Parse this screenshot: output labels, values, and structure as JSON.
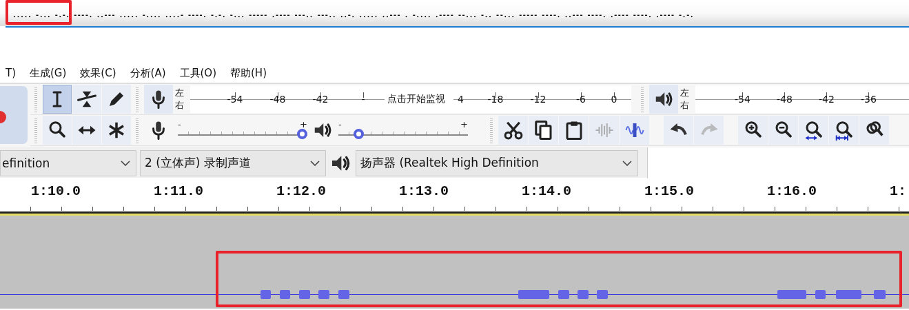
{
  "title_bar": {
    "text": "..... -... -.-. ----. ..--- ..... -.... ....- ----. -.-. -... ----- .---- ---.. ---.. ..-. ..... ..--- . -.... .---- --... -.. --... ----- ----. ..--- ----. .---- ----. .---- -.-.",
    "highlighted": true
  },
  "track": {
    "highlighted": true
  },
  "menu": [
    {
      "label": "T)"
    },
    {
      "label": "生成(G)"
    },
    {
      "label": "效果(C)"
    },
    {
      "label": "分析(A)"
    },
    {
      "label": "工具(O)"
    },
    {
      "label": "帮助(H)"
    }
  ],
  "tools": [
    {
      "kind": "ibeam",
      "selected": true
    },
    {
      "kind": "envelope",
      "selected": false
    },
    {
      "kind": "pencil",
      "selected": false
    },
    {
      "kind": "zoom",
      "selected": false
    },
    {
      "kind": "timeshift",
      "selected": false
    },
    {
      "kind": "multi",
      "selected": false
    }
  ],
  "record_meter": {
    "channels": [
      "左",
      "右"
    ],
    "ticks": [
      "-54",
      "-48",
      "-42",
      "-"
    ],
    "hint": "点击开始监视",
    "ticks_after": [
      "4",
      "-18",
      "-12",
      "-6",
      "0"
    ]
  },
  "playback_meter": {
    "channels": [
      "左",
      "右"
    ],
    "ticks": [
      "-54",
      "-48",
      "-42",
      "-36"
    ]
  },
  "mixer": [
    {
      "kind": "record",
      "min_label": "-",
      "max_label": "+",
      "level": 1.0
    },
    {
      "kind": "playback",
      "min_label": "-",
      "max_label": "+",
      "level": 0.13
    }
  ],
  "edit_buttons": [
    {
      "kind": "cut",
      "disabled": false
    },
    {
      "kind": "copy",
      "disabled": false
    },
    {
      "kind": "paste",
      "disabled": false
    },
    {
      "kind": "trim",
      "disabled": true
    },
    {
      "kind": "silence",
      "disabled": false
    }
  ],
  "history_buttons": [
    {
      "kind": "undo",
      "disabled": false
    },
    {
      "kind": "redo",
      "disabled": true
    }
  ],
  "zoom_buttons": [
    {
      "kind": "zoom-in"
    },
    {
      "kind": "zoom-out"
    },
    {
      "kind": "fit-selection"
    },
    {
      "kind": "fit-project"
    },
    {
      "kind": "zoom-toggle"
    }
  ],
  "devices": [
    {
      "kind": "combo",
      "value": "efinition"
    },
    {
      "kind": "combo",
      "value": "2 (立体声) 录制声道"
    },
    {
      "kind": "speaker"
    },
    {
      "kind": "combo",
      "value": "扬声器 (Realtek High Definition"
    }
  ],
  "timeline": {
    "labels": [
      "1:10.0",
      "1:11.0",
      "1:12.0",
      "1:13.0",
      "1:14.0",
      "1:15.0",
      "1:16.0",
      "1:"
    ]
  }
}
